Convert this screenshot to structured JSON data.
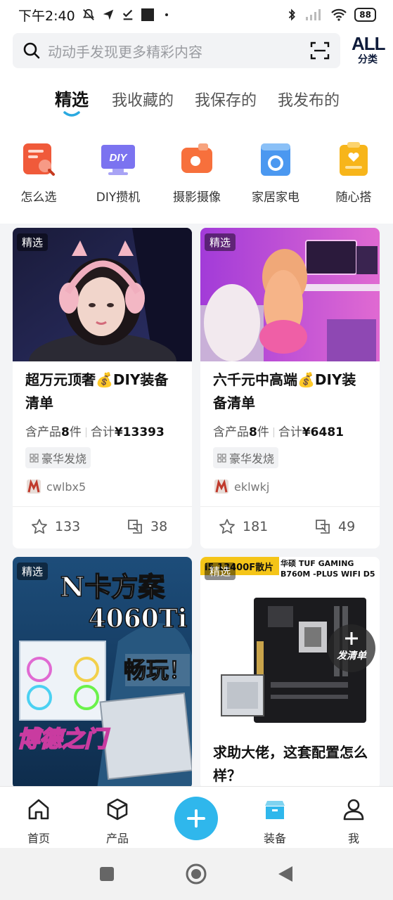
{
  "status": {
    "time": "下午2:40",
    "battery": "88"
  },
  "search": {
    "placeholder": "动动手发现更多精彩内容",
    "all_big": "ALL",
    "all_small": "分类"
  },
  "tabs": [
    "精选",
    "我收藏的",
    "我保存的",
    "我发布的"
  ],
  "categories": [
    {
      "label": "怎么选",
      "icon": "how-to-choose-icon"
    },
    {
      "label": "DIY攒机",
      "icon": "diy-pc-icon"
    },
    {
      "label": "摄影摄像",
      "icon": "camera-icon"
    },
    {
      "label": "家居家电",
      "icon": "washer-icon"
    },
    {
      "label": "随心搭",
      "icon": "heart-clipboard-icon"
    }
  ],
  "diy_icon_text": "DIY",
  "cards": [
    {
      "badge": "精选",
      "title": "超万元顶奢💰DIY装备清单",
      "count_prefix": "含产品",
      "count": "8",
      "count_suffix": "件",
      "total_label": "合计",
      "total": "¥13393",
      "tag": "豪华发烧",
      "author": "cwlbx5",
      "likes": "133",
      "shares": "38"
    },
    {
      "badge": "精选",
      "title": "六千元中高端💰DIY装备清单",
      "count_prefix": "含产品",
      "count": "8",
      "count_suffix": "件",
      "total_label": "合计",
      "total": "¥6481",
      "tag": "豪华发烧",
      "author": "eklwkj",
      "likes": "181",
      "shares": "49"
    },
    {
      "badge": "精选",
      "image_text": {
        "line1": "N卡方案",
        "line2": "4060Ti",
        "line3": "畅玩！",
        "brand": "博德之门"
      }
    },
    {
      "badge": "精选",
      "image_text": {
        "left_banner": "i5 13400F散片",
        "right_banner": "华硕 TUF GAMING B760M -PLUS WIFI D5"
      },
      "title": "求助大佬，这套配置怎么样？"
    }
  ],
  "floating_button": {
    "label": "发清单"
  },
  "bottom_nav": [
    {
      "label": "首页",
      "icon": "home-icon"
    },
    {
      "label": "产品",
      "icon": "cube-icon"
    },
    {
      "label": "装备",
      "icon": "box-icon"
    },
    {
      "label": "我",
      "icon": "user-icon"
    }
  ],
  "colors": {
    "accent": "#2fb7ec",
    "active_tab_underline": "#2aa9e0"
  }
}
